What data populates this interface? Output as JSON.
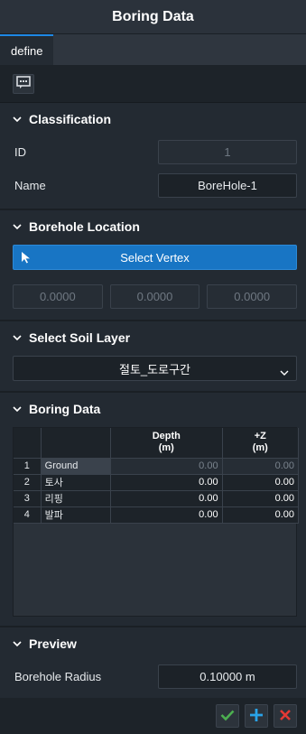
{
  "window": {
    "title": "Boring Data"
  },
  "tabs": [
    {
      "label": "define",
      "active": true
    }
  ],
  "toolbar": {
    "icon": "comment-box-icon"
  },
  "classification": {
    "header": "Classification",
    "id_label": "ID",
    "id_value": "1",
    "name_label": "Name",
    "name_value": "BoreHole-1"
  },
  "borehole_location": {
    "header": "Borehole Location",
    "select_vertex_label": "Select Vertex",
    "coords": [
      "0.0000",
      "0.0000",
      "0.0000"
    ]
  },
  "soil_layer": {
    "header": "Select Soil Layer",
    "selected": "절토_도로구간"
  },
  "boring_data": {
    "header": "Boring Data",
    "columns": [
      {
        "label": "Depth",
        "unit": "(m)"
      },
      {
        "label": "+Z",
        "unit": "(m)"
      }
    ],
    "rows": [
      {
        "index": "1",
        "name": "Ground",
        "depth": "0.00",
        "z": "0.00"
      },
      {
        "index": "2",
        "name": "토사",
        "depth": "0.00",
        "z": "0.00"
      },
      {
        "index": "3",
        "name": "리핑",
        "depth": "0.00",
        "z": "0.00"
      },
      {
        "index": "4",
        "name": "발파",
        "depth": "0.00",
        "z": "0.00"
      }
    ]
  },
  "preview": {
    "header": "Preview",
    "radius_label": "Borehole Radius",
    "radius_value": "0.10000 m"
  },
  "footer": {
    "buttons": [
      "confirm-check-icon",
      "add-plus-icon",
      "cancel-x-icon"
    ],
    "colors": {
      "check": "#4caf50",
      "plus": "#29a3e8",
      "close": "#e53935"
    }
  },
  "colors": {
    "accent": "#1875c4",
    "tab_highlight": "#1e88e5"
  }
}
